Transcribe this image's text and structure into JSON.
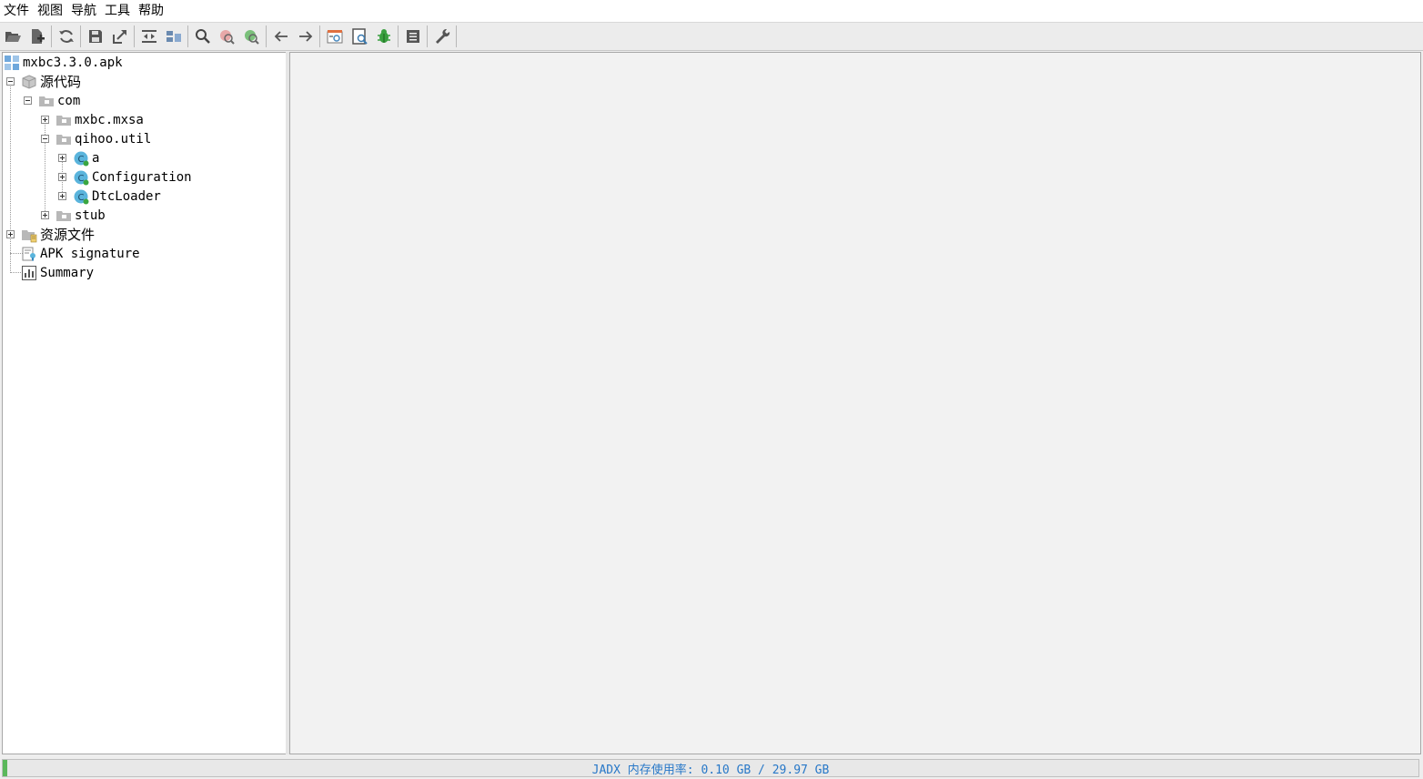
{
  "menu": [
    "文件",
    "视图",
    "导航",
    "工具",
    "帮助"
  ],
  "toolbar": [
    "folder-open-icon",
    "add-file-icon",
    "sep",
    "sync-icon",
    "sep",
    "save-icon",
    "export-icon",
    "sep",
    "sync-tree-icon",
    "flatten-icon",
    "sep",
    "search-icon",
    "search-class-icon",
    "search-usage-icon",
    "sep",
    "back-icon",
    "forward-icon",
    "sep",
    "deobfuscation-icon",
    "quick-tab-icon",
    "debug-icon",
    "sep",
    "log-icon",
    "sep",
    "settings-icon",
    "sep"
  ],
  "tree": {
    "root": "mxbc3.3.0.apk",
    "source_code": "源代码",
    "com": "com",
    "mxbc": "mxbc.mxsa",
    "qihoo": "qihoo.util",
    "class_a": "a",
    "class_configuration": "Configuration",
    "class_dtcloader": "DtcLoader",
    "stub": "stub",
    "resources": "资源文件",
    "apk_signature": "APK signature",
    "summary": "Summary"
  },
  "status": {
    "memory_text": "JADX 内存使用率: 0.10 GB / 29.97 GB",
    "memory_fraction": 0.003
  },
  "colors": {
    "status_text": "#2878c8",
    "progress": "#5cb85c",
    "class_icon": "#5ab4dc"
  }
}
